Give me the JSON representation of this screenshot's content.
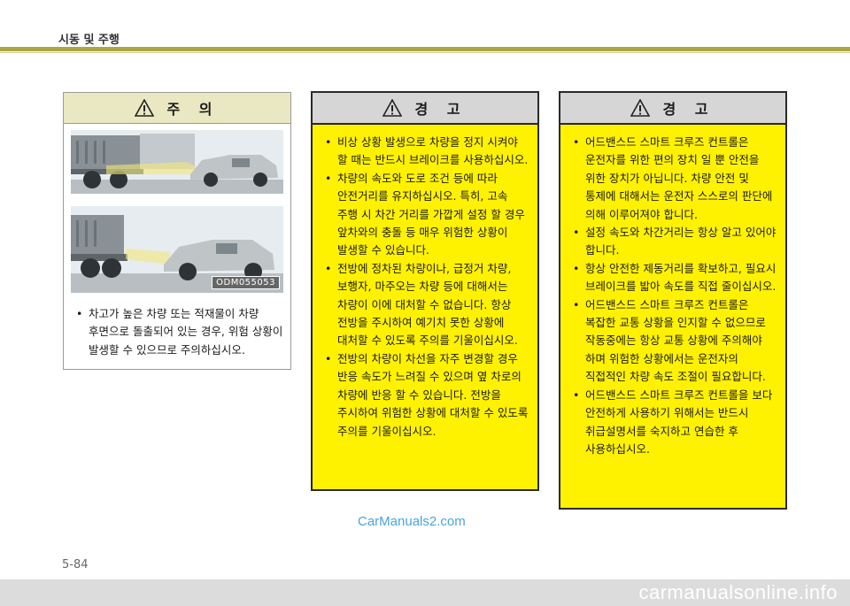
{
  "header": {
    "title": "시동 및 주행"
  },
  "caution": {
    "title": "주 의",
    "image_code": "ODM055053",
    "items": [
      "차고가 높은 차량 또는 적재물이 차량 후면으로 돌출되어 있는 경우, 위험 상황이 발생할 수 있으므로 주의하십시오."
    ]
  },
  "warning1": {
    "title": "경 고",
    "items": [
      "비상 상황 발생으로 차량을 정지 시켜야 할 때는 반드시 브레이크를 사용하십시오.",
      "차량의 속도와 도로 조건 등에 따라 안전거리를 유지하십시오. 특히, 고속 주행 시 차간 거리를 가깝게 설정 할 경우 앞차와의 충돌 등 매우 위험한 상황이 발생할 수 있습니다.",
      "전방에 정차된 차량이나, 급정거 차량, 보행자, 마주오는 차량 등에 대해서는 차량이 이에 대처할 수 없습니다. 항상 전방을 주시하여 예기치 못한 상황에 대처할 수 있도록 주의를 기울이십시오.",
      "전방의 차량이 차선을 자주 변경할 경우 반응 속도가 느려질 수 있으며 옆 차로의 차량에 반응 할 수 있습니다. 전방을 주시하여 위험한 상황에 대처할 수 있도록 주의를 기울이십시오."
    ]
  },
  "warning2": {
    "title": "경 고",
    "items": [
      "어드밴스드 스마트 크루즈 컨트롤은 운전자를 위한 편의 장치 일 뿐 안전을 위한 장치가 아닙니다. 차량 안전 및 통제에 대해서는 운전자 스스로의 판단에 의해 이루어져야 합니다.",
      "설정 속도와 차간거리는 항상 알고 있어야 합니다.",
      "항상 안전한 제동거리를 확보하고, 필요시 브레이크를 밟아 속도를 직접 줄이십시오.",
      "어드밴스드 스마트 크루즈 컨트롤은 복잡한 교통 상황을 인지할 수 없으므로 작동중에는 항상 교통 상황에 주의해야 하며 위험한 상황에서는 운전자의 직접적인 차량 속도 조절이 필요합니다.",
      "어드밴스드 스마트 크루즈 컨트롤을 보다 안전하게 사용하기 위해서는 반드시 취급설명서를 숙지하고 연습한 후 사용하십시오."
    ]
  },
  "watermark": "CarManuals2.com",
  "page_number": "5-84",
  "footer": "carmanualsonline.info"
}
